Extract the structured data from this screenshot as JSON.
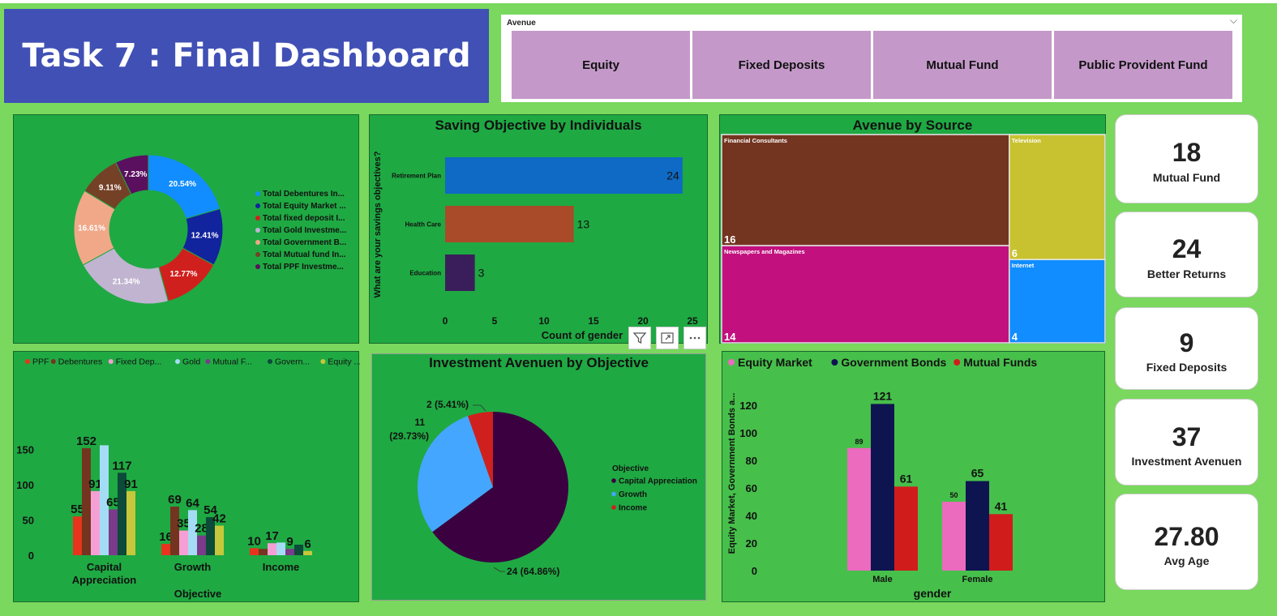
{
  "header": {
    "title": "Task 7 : Final Dashboard"
  },
  "slicer": {
    "title": "Avenue",
    "options": [
      "Equity",
      "Fixed Deposits",
      "Mutual Fund",
      "Public Provident Fund"
    ]
  },
  "cards": [
    {
      "value": "18",
      "label": "Mutual Fund"
    },
    {
      "value": "24",
      "label": "Better Returns"
    },
    {
      "value": "9",
      "label": "Fixed Deposits"
    },
    {
      "value": "37",
      "label": "Investment Avenuen"
    },
    {
      "value": "27.80",
      "label": "Avg Age"
    }
  ],
  "colors": {
    "background": "#79d85d",
    "title_bg": "#4050b5",
    "panel": "#1fa943",
    "slicer_button": "#c499c9"
  },
  "icons": [
    "filter-icon",
    "focus-mode-icon",
    "more-options-icon",
    "chevron-down-icon"
  ],
  "chart_data": [
    {
      "id": "donut",
      "type": "pie",
      "donut": true,
      "title": "",
      "labels": [
        "Total Debentures In...",
        "Total Equity Market ...",
        "Total fixed deposit I...",
        "Total Gold Investme...",
        "Total Government B...",
        "Total Mutual fund In...",
        "Total PPF Investme..."
      ],
      "values": [
        20.54,
        12.41,
        12.77,
        21.34,
        16.61,
        9.11,
        7.23
      ],
      "value_labels": [
        "20.54%",
        "12.41%",
        "12.77%",
        "21.34%",
        "16.61%",
        "9.11%",
        "7.23%"
      ],
      "colors": [
        "#118dff",
        "#12239e",
        "#d0201d",
        "#c0b4d0",
        "#f0a888",
        "#744127",
        "#5a105e"
      ],
      "legend": "right"
    },
    {
      "id": "saving",
      "type": "bar",
      "orientation": "horizontal",
      "title": "Saving Objective by Individuals",
      "categories": [
        "Retirement Plan",
        "Health Care",
        "Education"
      ],
      "values": [
        24,
        13,
        3
      ],
      "colors": [
        "#0e6ac5",
        "#a94a28",
        "#3a1e5b"
      ],
      "xlabel": "Count of gender",
      "ylabel": "What are your savings objectives?",
      "xticks": [
        "0",
        "5",
        "10",
        "15",
        "20",
        "25"
      ],
      "xlim": [
        0,
        25
      ]
    },
    {
      "id": "treemap",
      "type": "treemap",
      "title": "Avenue by Source",
      "labels": [
        "Financial Consultants",
        "Television",
        "Newspapers and Magazines",
        "Internet"
      ],
      "values": [
        16,
        6,
        14,
        4
      ],
      "colors": [
        "#743520",
        "#c8c230",
        "#c2117e",
        "#118dff"
      ]
    },
    {
      "id": "grouped",
      "type": "bar",
      "title": "",
      "categories": [
        "Capital Appreciation",
        "Growth",
        "Income"
      ],
      "category_lines": [
        [
          "Capital",
          "Appreciation"
        ],
        [
          "Growth"
        ],
        [
          "Income"
        ]
      ],
      "series": [
        {
          "name": "PPF",
          "color": "#e8341c",
          "values": [
            55,
            16,
            10
          ]
        },
        {
          "name": "Debentures",
          "color": "#743520",
          "values": [
            152,
            69,
            9
          ]
        },
        {
          "name": "Fixed Dep...",
          "color": "#f5a0d4",
          "values": [
            91,
            35,
            17
          ]
        },
        {
          "name": "Gold",
          "color": "#a5dcf5",
          "values": [
            156,
            64,
            18
          ]
        },
        {
          "name": "Mutual F...",
          "color": "#7b3a8a",
          "values": [
            65,
            28,
            9
          ]
        },
        {
          "name": "Govern...",
          "color": "#0c4a3a",
          "values": [
            117,
            54,
            15
          ]
        },
        {
          "name": "Equity ...",
          "color": "#c7c73b",
          "values": [
            91,
            42,
            6
          ]
        }
      ],
      "data_labels": [
        [
          "55",
          "152",
          "91",
          "",
          "65",
          "117",
          "91"
        ],
        [
          "16",
          "69",
          "35",
          "64",
          "28",
          "54",
          "42"
        ],
        [
          "10",
          "",
          "17",
          "",
          "9",
          "",
          "6"
        ]
      ],
      "xlabel": "Objective",
      "yticks": [
        "0",
        "50",
        "100",
        "150"
      ],
      "ylim": [
        0,
        170
      ],
      "legend": "top-left"
    },
    {
      "id": "pie",
      "type": "pie",
      "title": "Investment Avenuen by Objective",
      "legend_title": "Objective",
      "labels": [
        "Capital Appreciation",
        "Growth",
        "Income"
      ],
      "values": [
        24,
        11,
        2
      ],
      "value_labels": [
        "24 (64.86%)",
        "11\n(29.73%)",
        "2 (5.41%)"
      ],
      "colors": [
        "#3a0040",
        "#45a6ff",
        "#d0201d"
      ],
      "legend": "right"
    },
    {
      "id": "gender",
      "type": "bar",
      "title": "",
      "categories": [
        "Male",
        "Female"
      ],
      "series": [
        {
          "name": "Equity Market",
          "color": "#eb6bbe",
          "values": [
            89,
            50
          ]
        },
        {
          "name": "Government Bonds",
          "color": "#0d1450",
          "values": [
            121,
            65
          ]
        },
        {
          "name": "Mutual Funds",
          "color": "#d11c1c",
          "values": [
            61,
            41
          ]
        }
      ],
      "xlabel": "gender",
      "ylabel": "Equity Market, Government Bonds a...",
      "yticks": [
        "0",
        "20",
        "40",
        "60",
        "80",
        "100",
        "120"
      ],
      "ylim": [
        0,
        126
      ],
      "legend": "top"
    }
  ]
}
